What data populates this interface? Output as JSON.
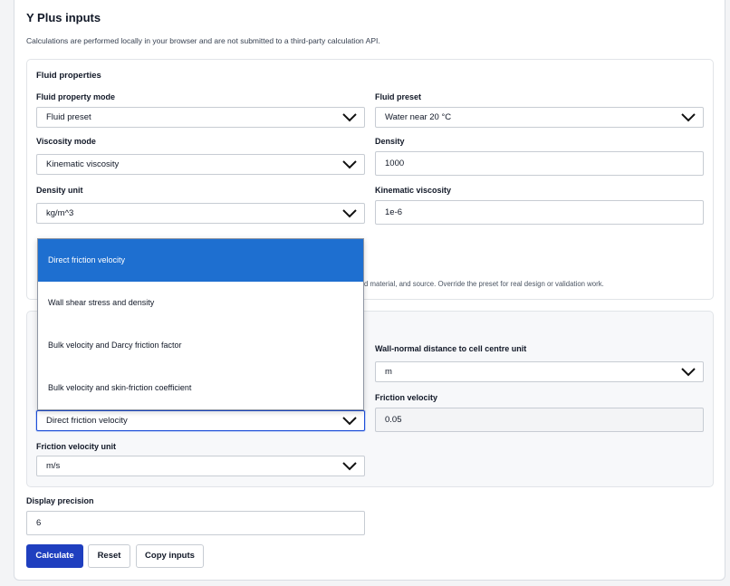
{
  "page": {
    "title": "Y Plus inputs",
    "note": "Calculations are performed locally in your browser and are not submitted to a third-party calculation API."
  },
  "fluid": {
    "section_title": "Fluid properties",
    "property_mode_label": "Fluid property mode",
    "property_mode_value": "Fluid preset",
    "preset_label": "Fluid preset",
    "preset_value": "Water near 20 °C",
    "viscosity_mode_label": "Viscosity mode",
    "viscosity_mode_value": "Kinematic viscosity",
    "density_label": "Density",
    "density_value": "1000",
    "density_unit_label": "Density unit",
    "density_unit_value": "kg/m^3",
    "kinematic_viscosity_label": "Kinematic viscosity",
    "kinematic_viscosity_value": "1e-6",
    "preset_hint_fragment": "d material, and source. Override the preset for real design or validation work."
  },
  "wall": {
    "distance_unit_label": "Wall-normal distance to cell centre unit",
    "distance_unit_value": "m",
    "friction_velocity_label": "Friction velocity",
    "friction_velocity_value": "0.05",
    "friction_mode_value": "Direct friction velocity",
    "friction_velocity_unit_label": "Friction velocity unit",
    "friction_velocity_unit_value": "m/s"
  },
  "dropdown": {
    "options": [
      "Direct friction velocity",
      "Wall shear stress and density",
      "Bulk velocity and Darcy friction factor",
      "Bulk velocity and skin-friction coefficient"
    ],
    "selected_index": 0
  },
  "precision": {
    "label": "Display precision",
    "value": "6"
  },
  "actions": {
    "calculate": "Calculate",
    "reset": "Reset",
    "copy": "Copy inputs"
  },
  "colors": {
    "accent": "#1f3fbf",
    "selection": "#1e6fd0"
  }
}
